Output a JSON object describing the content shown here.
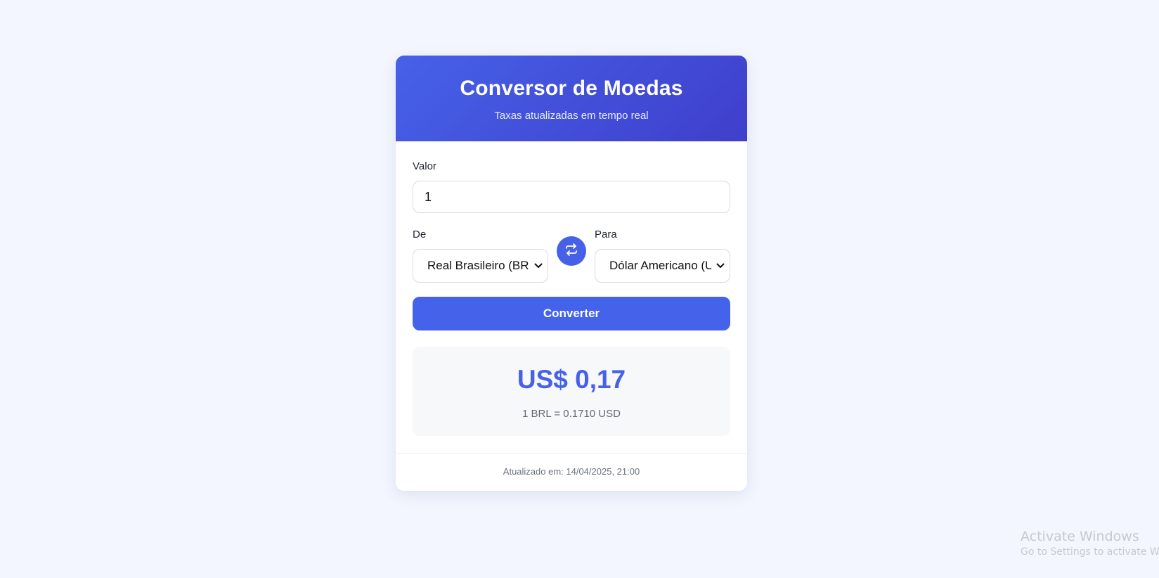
{
  "header": {
    "title": "Conversor de Moedas",
    "subtitle": "Taxas atualizadas em tempo real"
  },
  "form": {
    "amount_label": "Valor",
    "amount_value": "1",
    "from_label": "De",
    "from_selected": "Real Brasileiro (BRL)",
    "to_label": "Para",
    "to_selected": "Dólar Americano (USD)",
    "swap_icon": "swap-arrows-icon",
    "convert_label": "Converter"
  },
  "result": {
    "amount": "US$ 0,17",
    "rate": "1 BRL = 0.1710 USD"
  },
  "footer": {
    "updated": "Atualizado em: 14/04/2025, 21:00"
  },
  "watermark": {
    "title": "Activate Windows",
    "subtitle": "Go to Settings to activate Windows."
  },
  "colors": {
    "accent": "#4661e8",
    "header_gradient_start": "#4661e8",
    "header_gradient_end": "#3f3fcb",
    "page_background": "#f3f6fe"
  }
}
